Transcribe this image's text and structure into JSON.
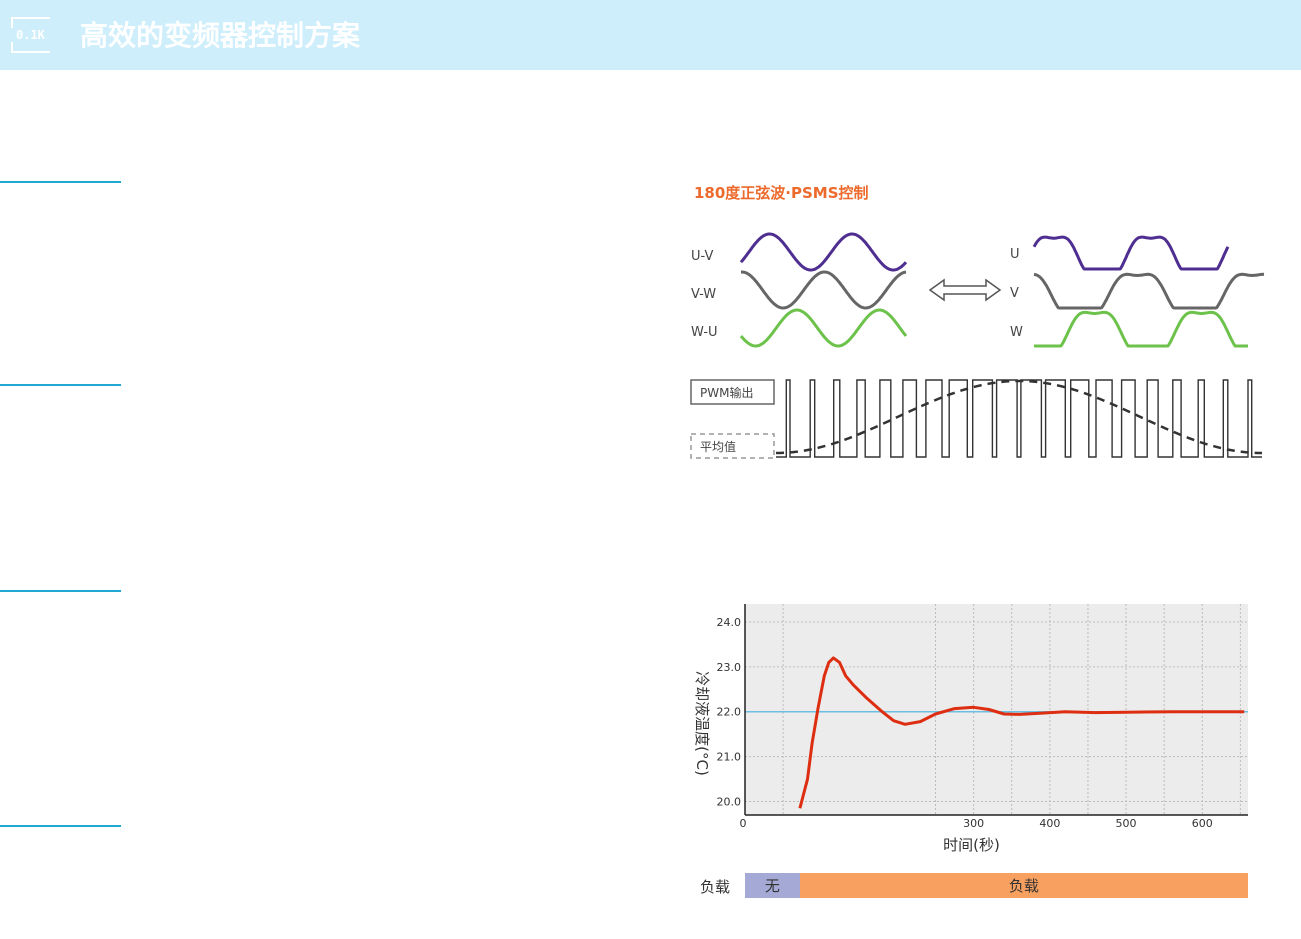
{
  "header": {
    "logo_text": "0.1K",
    "title": "高效的变频器控制方案"
  },
  "waveform": {
    "section_title": "180度正弦波·PSMS控制",
    "left_labels": [
      "U-V",
      "V-W",
      "W-U"
    ],
    "right_labels": [
      "U",
      "V",
      "W"
    ],
    "colors": {
      "purple": "#4f2e91",
      "gray": "#666666",
      "green": "#6cc24a"
    },
    "pwm_label": "PWM输出",
    "avg_label": "平均值"
  },
  "chart_data": {
    "type": "line",
    "xlabel": "时间(秒)",
    "ylabel": "冷却液温度(°C)",
    "xlim": [
      0,
      660
    ],
    "ylim": [
      19.7,
      24.4
    ],
    "x_ticks": [
      "0",
      "300",
      "400",
      "500",
      "600"
    ],
    "y_ticks": [
      "24.0",
      "23.0",
      "22.0",
      "21.0",
      "20.0"
    ],
    "grid": true,
    "setpoint": 22.0,
    "series": [
      {
        "color": "#dd2e12",
        "x": [
          72,
          82,
          88,
          96,
          104,
          110,
          116,
          124,
          132,
          142,
          160,
          180,
          195,
          210,
          230,
          250,
          275,
          300,
          320,
          340,
          360,
          390,
          420,
          460,
          500,
          560,
          620,
          655
        ],
        "y": [
          19.85,
          20.5,
          21.3,
          22.1,
          22.8,
          23.1,
          23.2,
          23.1,
          22.8,
          22.6,
          22.3,
          22.0,
          21.8,
          21.72,
          21.78,
          21.95,
          22.07,
          22.1,
          22.05,
          21.95,
          21.94,
          21.97,
          22.0,
          21.98,
          21.99,
          22.0,
          22.0,
          22.0
        ]
      }
    ],
    "load_bar": {
      "label": "负载",
      "segments": [
        {
          "label": "无",
          "start": 0,
          "end": 72,
          "color": "#a5a9d6"
        },
        {
          "label": "负载",
          "start": 72,
          "end": 660,
          "color": "#f8a060"
        }
      ]
    }
  }
}
